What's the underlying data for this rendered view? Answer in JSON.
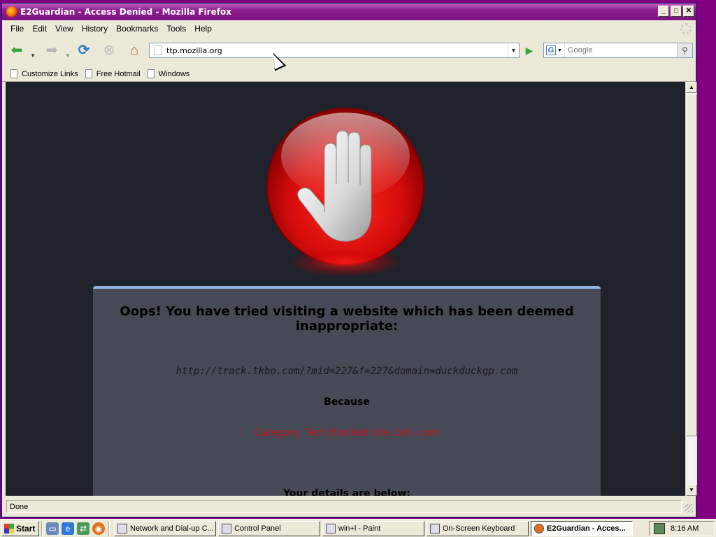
{
  "window": {
    "title": "E2Guardian - Access Denied - Mozilla Firefox",
    "buttons": {
      "minimize": "_",
      "maximize": "□",
      "close": "✕"
    }
  },
  "menu": [
    "File",
    "Edit",
    "View",
    "History",
    "Bookmarks",
    "Tools",
    "Help"
  ],
  "nav": {
    "url": "ttp.mozilla.org",
    "search_placeholder": "Google"
  },
  "bookmarks": [
    "Customize Links",
    "Free Hotmail",
    "Windows"
  ],
  "page": {
    "heading": "Oops! You have tried visiting a website which has been deemed inappropriate:",
    "blocked_url": "http://track.tkbo.com/?mid=227&f=227&domain=duckduckgp.com",
    "because": "Because",
    "reason": "Category: Tech  Blocked site: bkt-.com",
    "details_heading": "Your details are below:"
  },
  "status": {
    "text": "Done"
  },
  "taskbar": {
    "start": "Start",
    "tasks": [
      {
        "label": "Network and Dial-up C...",
        "active": false
      },
      {
        "label": "Control Panel",
        "active": false
      },
      {
        "label": "win+l - Paint",
        "active": false
      },
      {
        "label": "On-Screen Keyboard",
        "active": false
      },
      {
        "label": "E2Guardian - Acces...",
        "active": true
      }
    ],
    "clock": "8:16 AM"
  },
  "colors": {
    "title_bar": "#8e1f90",
    "desktop": "#800080",
    "page_bg": "#1f222a",
    "panel_bg": "#464a57",
    "panel_border": "#8fb6e0",
    "reason_text": "#c1121c",
    "stop_red": "#e01010"
  },
  "icons": [
    "firefox-icon",
    "back-arrow-icon",
    "forward-arrow-icon",
    "reload-icon",
    "stop-icon",
    "home-icon",
    "go-arrow-icon",
    "google-icon",
    "magnifier-icon",
    "page-icon",
    "stop-hand-icon",
    "windows-logo-icon",
    "tray-network-icon",
    "gear-icon"
  ]
}
